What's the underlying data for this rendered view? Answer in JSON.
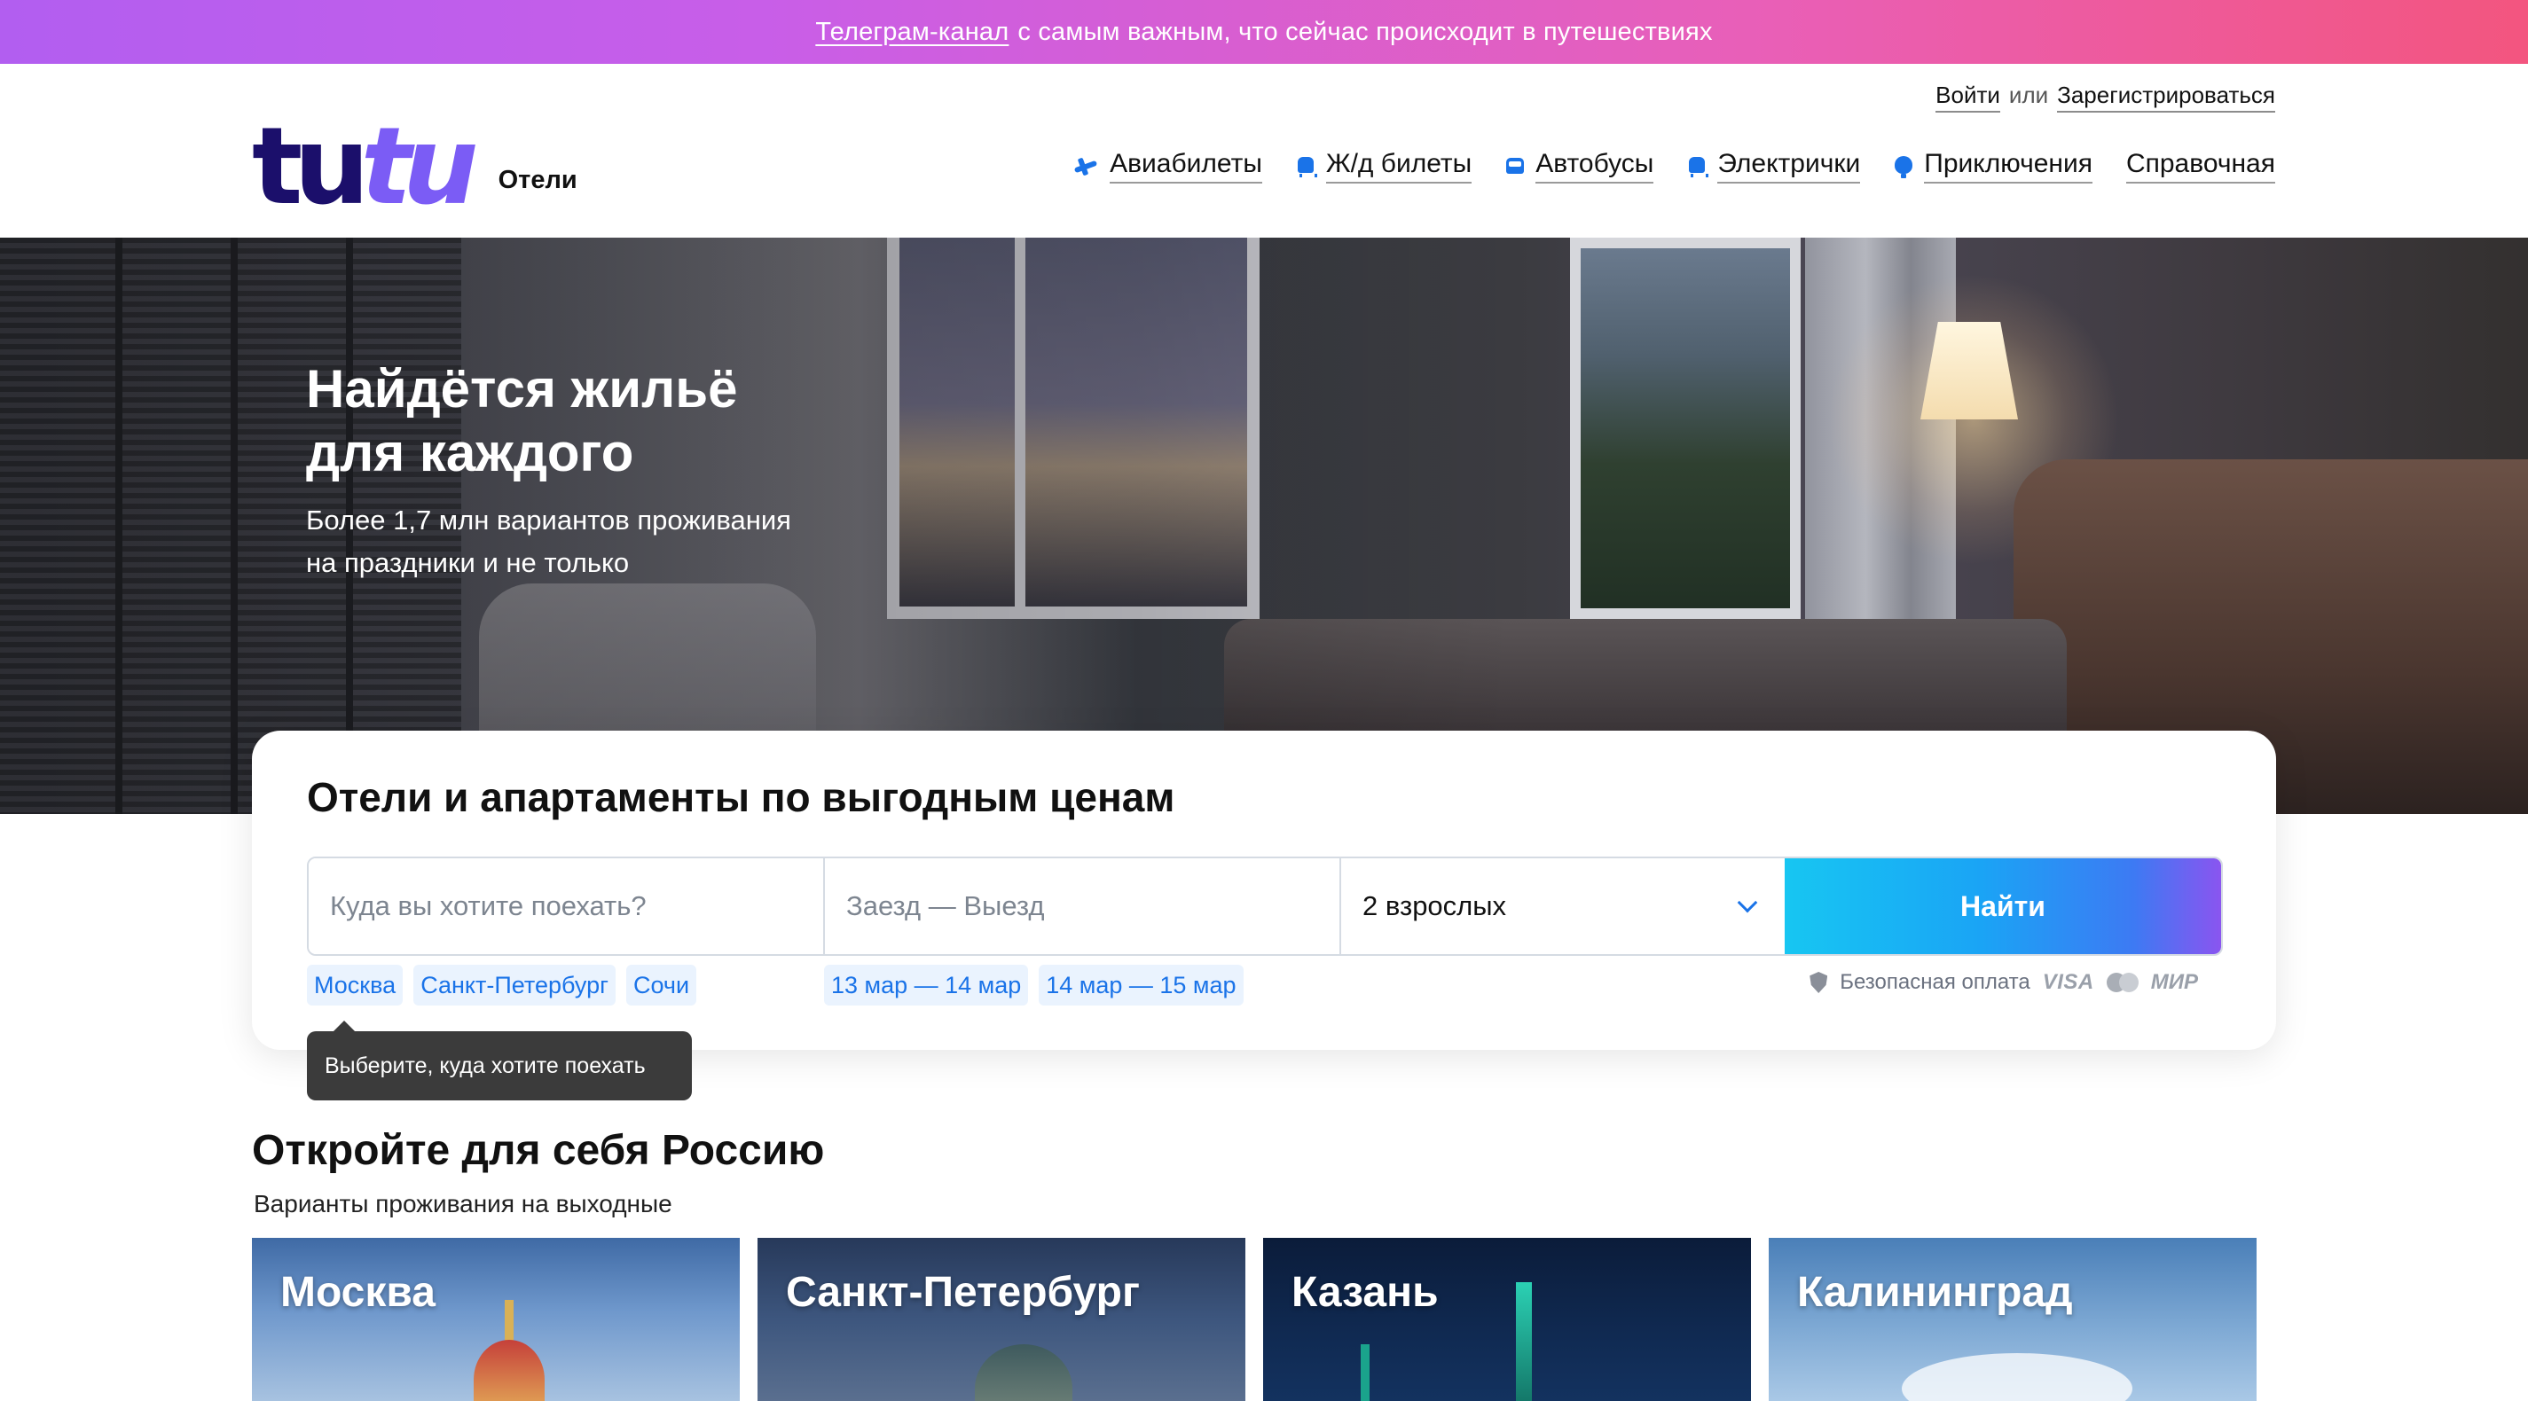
{
  "promo": {
    "link_text": "Телеграм-канал",
    "text": "с самым важным, что сейчас происходит в путешествиях"
  },
  "auth": {
    "login": "Войти",
    "or": "или",
    "register": "Зарегистрироваться"
  },
  "logo": {
    "part1": "tu",
    "part2": "tu",
    "section": "Отели"
  },
  "nav": {
    "items": [
      {
        "label": "Авиабилеты",
        "icon": "plane-icon"
      },
      {
        "label": "Ж/д билеты",
        "icon": "train-icon"
      },
      {
        "label": "Автобусы",
        "icon": "bus-icon"
      },
      {
        "label": "Электрички",
        "icon": "commuter-train-icon"
      },
      {
        "label": "Приключения",
        "icon": "balloon-icon"
      },
      {
        "label": "Справочная"
      }
    ]
  },
  "hero": {
    "title_line1": "Найдётся жильё",
    "title_line2": "для каждого",
    "subtitle_line1": "Более 1,7 млн вариантов проживания",
    "subtitle_line2": "на праздники и не только"
  },
  "search": {
    "title": "Отели и апартаменты по выгодным ценам",
    "destination_placeholder": "Куда вы хотите поехать?",
    "dates_placeholder": "Заезд — Выезд",
    "guests_value": "2 взрослых",
    "button_label": "Найти",
    "destination_chips": [
      "Москва",
      "Санкт-Петербург",
      "Сочи"
    ],
    "date_chips": [
      "13 мар — 14 мар",
      "14 мар — 15 мар"
    ],
    "payment_label": "Безопасная оплата",
    "visa": "VISA",
    "mir": "МИР",
    "tooltip": "Выберите, куда хотите поехать"
  },
  "discover": {
    "title": "Откройте для себя Россию",
    "subtitle": "Варианты проживания на выходные",
    "cities": [
      "Москва",
      "Санкт-Петербург",
      "Казань",
      "Калининград"
    ]
  },
  "colors": {
    "accent": "#1a73e8",
    "logo_dark": "#1b0f6b",
    "logo_light": "#7b5cf5"
  }
}
